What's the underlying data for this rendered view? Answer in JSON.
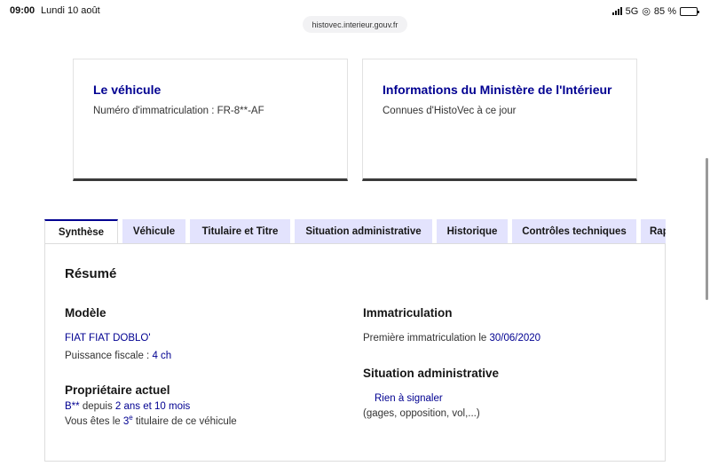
{
  "status_bar": {
    "time": "09:00",
    "date": "Lundi 10 août",
    "network": "5G",
    "battery": "85 %",
    "battery_percent": 85
  },
  "browser": {
    "url": "histovec.interieur.gouv.fr"
  },
  "cards": {
    "vehicle": {
      "title": "Le véhicule",
      "text": "Numéro d'immatriculation : FR-8**-AF"
    },
    "ministry": {
      "title": "Informations du Ministère de l'Intérieur",
      "text": "Connues d'HistoVec à ce jour"
    }
  },
  "tabs": [
    {
      "label": "Synthèse",
      "active": true
    },
    {
      "label": "Véhicule",
      "active": false
    },
    {
      "label": "Titulaire et Titre",
      "active": false
    },
    {
      "label": "Situation administrative",
      "active": false
    },
    {
      "label": "Historique",
      "active": false
    },
    {
      "label": "Contrôles techniques",
      "active": false
    },
    {
      "label": "Rap",
      "active": false
    }
  ],
  "summary": {
    "title": "Résumé",
    "model": {
      "heading": "Modèle",
      "name": "FIAT FIAT DOBLO'",
      "power_label": "Puissance fiscale : ",
      "power_value": "4 ch"
    },
    "owner": {
      "heading": "Propriétaire actuel",
      "initial": "B**",
      "since_label": " depuis ",
      "since_value": "2 ans et 10 mois",
      "rank_prefix": "Vous êtes le ",
      "rank_value": "3",
      "rank_suffix": "e",
      "rank_tail": " titulaire de ce véhicule"
    },
    "registration": {
      "heading": "Immatriculation",
      "label": "Première immatriculation le ",
      "value": "30/06/2020"
    },
    "admin": {
      "heading": "Situation administrative",
      "status": "Rien à signaler",
      "note": "(gages, opposition, vol,...)"
    }
  },
  "colors": {
    "accent": "#000091",
    "tab_bg": "#e3e3fd",
    "card_border": "#3a3a3a"
  }
}
